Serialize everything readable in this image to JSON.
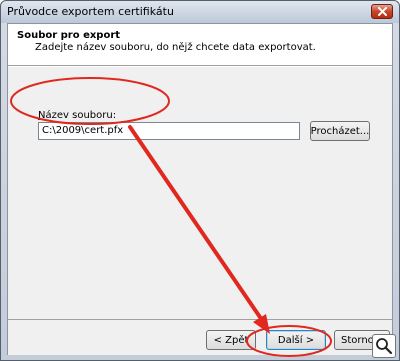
{
  "window": {
    "title": "Průvodce exportem certifikátu"
  },
  "header": {
    "title": "Soubor pro export",
    "subtitle": "Zadejte název souboru, do nějž chcete data exportovat."
  },
  "form": {
    "label_mnemonic": "N",
    "label_rest": "ázev souboru:",
    "filename_value": "C:\\2009\\cert.pfx",
    "browse_label": "Procházet..."
  },
  "footer": {
    "back_label": "< Zpět",
    "next_label": "Další >",
    "cancel_label": "Storno"
  },
  "icons": {
    "close": "close-icon",
    "zoom": "magnifier-icon"
  },
  "colors": {
    "annotation_red": "#e0281e"
  }
}
